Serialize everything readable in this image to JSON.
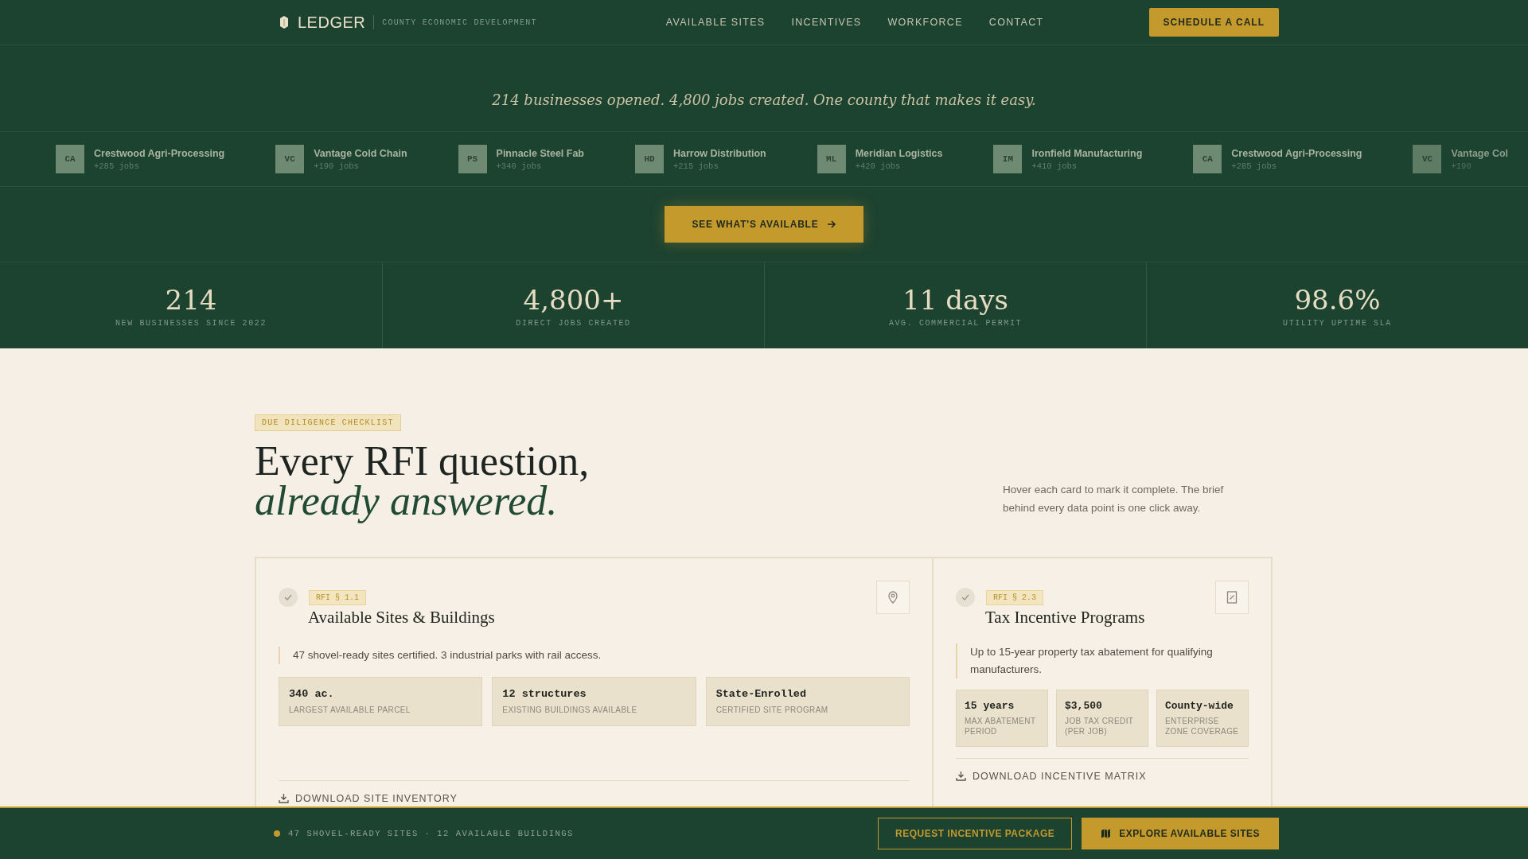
{
  "header": {
    "brand": "LEDGER",
    "tagline": "COUNTY ECONOMIC DEVELOPMENT",
    "nav": [
      "AVAILABLE SITES",
      "INCENTIVES",
      "WORKFORCE",
      "CONTACT"
    ],
    "cta": "SCHEDULE A CALL"
  },
  "hero": {
    "headline": "214 businesses opened. 4,800 jobs created. One county that makes it easy.",
    "button": "SEE WHAT'S AVAILABLE"
  },
  "ticker": [
    {
      "initials": "CA",
      "name": "Crestwood Agri-Processing",
      "jobs": "+285 jobs"
    },
    {
      "initials": "VC",
      "name": "Vantage Cold Chain",
      "jobs": "+190 jobs"
    },
    {
      "initials": "PS",
      "name": "Pinnacle Steel Fab",
      "jobs": "+340 jobs"
    },
    {
      "initials": "HD",
      "name": "Harrow Distribution",
      "jobs": "+215 jobs"
    },
    {
      "initials": "ML",
      "name": "Meridian Logistics",
      "jobs": "+420 jobs"
    },
    {
      "initials": "IM",
      "name": "Ironfield Manufacturing",
      "jobs": "+410 jobs"
    },
    {
      "initials": "CA",
      "name": "Crestwood Agri-Processing",
      "jobs": "+285 jobs"
    },
    {
      "initials": "VC",
      "name": "Vantage Col",
      "jobs": "+190"
    }
  ],
  "stats": [
    {
      "value": "214",
      "label": "NEW BUSINESSES SINCE 2022"
    },
    {
      "value": "4,800+",
      "label": "DIRECT JOBS CREATED"
    },
    {
      "value": "11 days",
      "label": "AVG. COMMERCIAL PERMIT"
    },
    {
      "value": "98.6%",
      "label": "UTILITY UPTIME SLA"
    }
  ],
  "section": {
    "eyebrow": "DUE DILIGENCE CHECKLIST",
    "title": "Every RFI question,",
    "title_italic": "already answered.",
    "intro": "Hover each card to mark it complete. The brief behind every data point is one click away."
  },
  "cards": [
    {
      "kind": "location",
      "complete": false,
      "tag": "RFI § 1.1",
      "title": "Available Sites & Buildings",
      "summary": "47 shovel-ready sites certified. 3 industrial parks with rail access.",
      "facts": [
        {
          "value": "340 ac.",
          "label": "LARGEST AVAILABLE PARCEL"
        },
        {
          "value": "12 structures",
          "label": "EXISTING BUILDINGS AVAILABLE"
        },
        {
          "value": "State-Enrolled",
          "label": "CERTIFIED SITE PROGRAM"
        }
      ],
      "download": "DOWNLOAD SITE INVENTORY"
    },
    {
      "kind": "tax",
      "complete": false,
      "tag": "RFI § 2.3",
      "title": "Tax Incentive Programs",
      "summary": "Up to 15-year property tax abatement for qualifying manufacturers.",
      "facts": [
        {
          "value": "15 years",
          "label": "MAX ABATEMENT PERIOD"
        },
        {
          "value": "$3,500",
          "label": "JOB TAX CREDIT (PER JOB)"
        },
        {
          "value": "County-wide",
          "label": "ENTERPRISE ZONE COVERAGE"
        }
      ],
      "download": "DOWNLOAD INCENTIVE MATRIX"
    }
  ],
  "footer_bar": {
    "status": "47 SHOVEL-READY SITES · 12 AVAILABLE BUILDINGS",
    "secondary": "REQUEST INCENTIVE PACKAGE",
    "primary": "EXPLORE AVAILABLE SITES"
  }
}
